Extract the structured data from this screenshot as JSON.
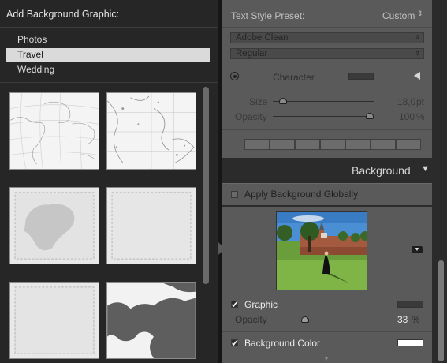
{
  "left_panel": {
    "title": "Add Background Graphic:",
    "categories": [
      {
        "label": "Photos",
        "selected": false
      },
      {
        "label": "Travel",
        "selected": true
      },
      {
        "label": "Wedding",
        "selected": false
      }
    ],
    "thumbnails": [
      "world-map",
      "map-detail",
      "map-europe-frame",
      "blank-frame",
      "blank-square",
      "map-silhouette"
    ]
  },
  "right_panel": {
    "text_style_preset_label": "Text Style Preset:",
    "text_style_preset_value": "Custom",
    "font_family": "Adobe Clean",
    "font_style": "Regular",
    "character_label": "Character",
    "size_label": "Size",
    "size_value": "18,0",
    "size_unit": "pt",
    "size_level": 0.1,
    "opacity_label": "Opacity",
    "opacity_value": "100",
    "opacity_unit": "%",
    "opacity_level": 1.0,
    "background_section_label": "Background",
    "apply_globally_label": "Apply Background Globally",
    "apply_globally_checked": false,
    "graphic_label": "Graphic",
    "graphic_checked": true,
    "graphic_opacity_label": "Opacity",
    "graphic_opacity_value": "33",
    "graphic_opacity_unit": "%",
    "graphic_opacity_level": 0.33,
    "background_color_label": "Background Color",
    "background_color_checked": true,
    "background_color": "#ffffff"
  }
}
